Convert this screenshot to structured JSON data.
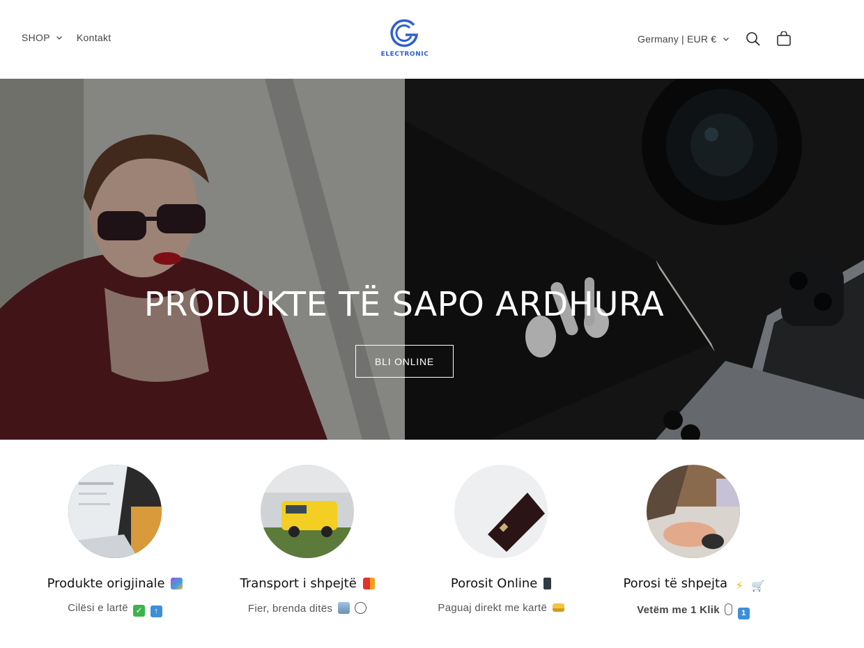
{
  "header": {
    "nav": [
      {
        "label": "SHOP",
        "has_dropdown": true
      },
      {
        "label": "Kontakt",
        "has_dropdown": false
      }
    ],
    "logo_text": "ELECTRONIC",
    "locale_label": "Germany | EUR €",
    "icons": [
      "chevron-down-icon",
      "search-icon",
      "cart-icon"
    ]
  },
  "hero": {
    "title": "PRODUKTE TË SAPO ARDHURA",
    "button_label": "BLI ONLINE"
  },
  "features": [
    {
      "title": "Produkte origjinale",
      "subtitle": "Cilësi e lartë",
      "title_icons": [
        "shopping-bags-icon"
      ],
      "sub_icons": [
        "check-mark-icon",
        "top-arrow-icon"
      ]
    },
    {
      "title": "Transport i shpejtë",
      "subtitle": "Fier, brenda ditës",
      "title_icons": [
        "delivery-truck-icon"
      ],
      "sub_icons": [
        "buildings-icon",
        "stopwatch-icon"
      ]
    },
    {
      "title": "Porosit Online",
      "subtitle": "Paguaj direkt me kartë",
      "title_icons": [
        "mobile-phone-icon"
      ],
      "sub_icons": [
        "credit-card-icon"
      ]
    },
    {
      "title": "Porosi të shpejta",
      "subtitle": "Vetëm me 1 Klik",
      "title_icons": [
        "lightning-icon",
        "shopping-cart-icon"
      ],
      "sub_icons": [
        "computer-mouse-icon",
        "keycap-one-icon"
      ]
    }
  ],
  "colors": {
    "brand_blue": "#2f5fd0",
    "text_dark": "#111111",
    "text_muted": "#555555"
  }
}
